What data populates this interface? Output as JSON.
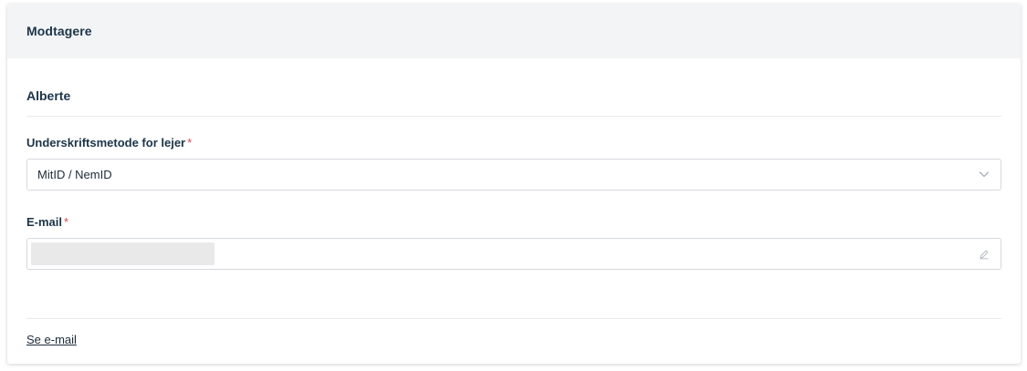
{
  "card": {
    "title": "Modtagere"
  },
  "recipient": {
    "name": "Alberte",
    "signature_method": {
      "label": "Underskriftsmetode for lejer",
      "required_marker": "*",
      "selected_value": "MitID / NemID"
    },
    "email": {
      "label": "E-mail",
      "required_marker": "*",
      "value": ""
    },
    "show_email_link": "Se e-mail"
  },
  "icons": {
    "select": "chevron-down-icon",
    "email_field": "pencil-edit-icon"
  },
  "colors": {
    "header_bg": "#f3f4f6",
    "text": "#1c3448",
    "required": "#e0464e",
    "border": "#d6d9de"
  }
}
